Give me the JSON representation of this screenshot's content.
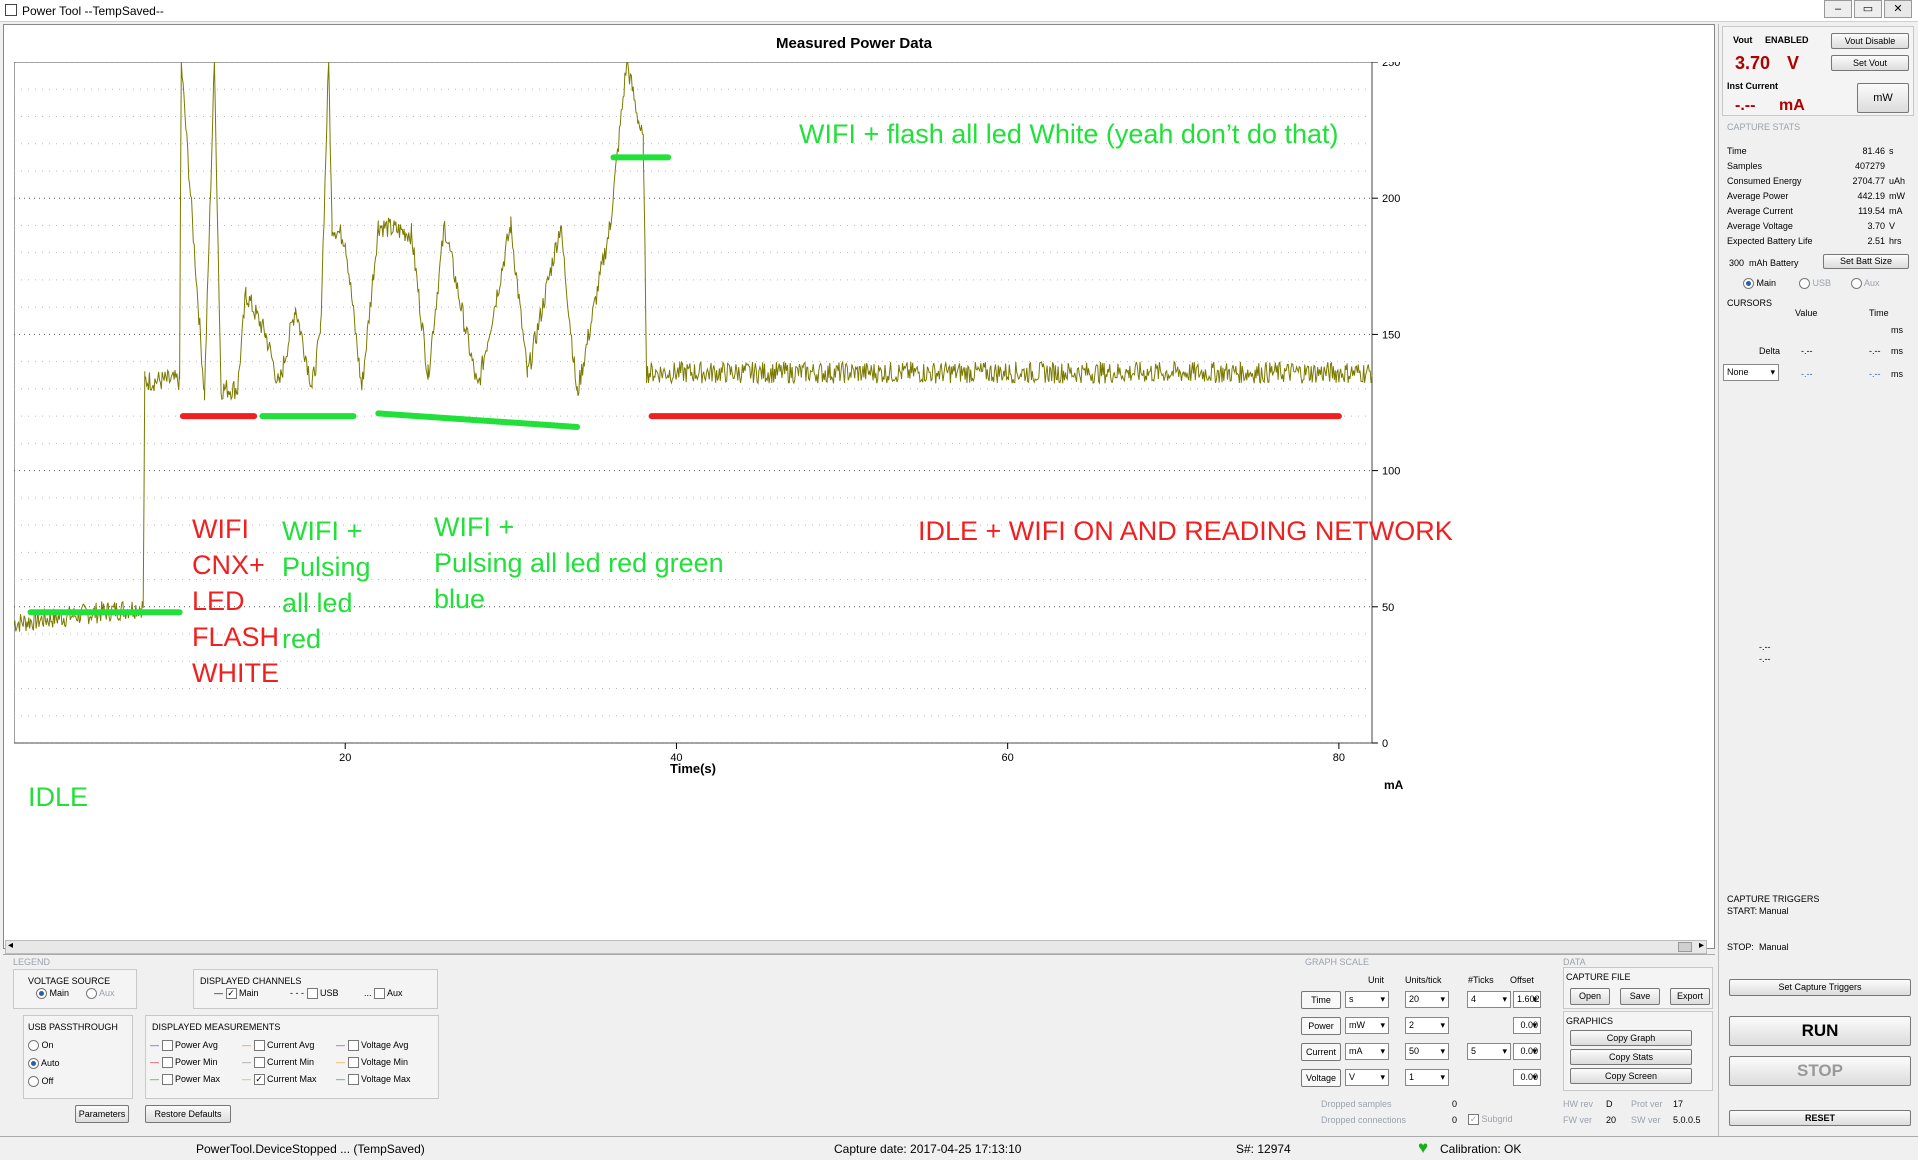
{
  "window": {
    "title": "Power Tool --TempSaved--",
    "controls": [
      "‒",
      "▭",
      "✕"
    ]
  },
  "chart_data": {
    "type": "line",
    "title": "Measured Power Data",
    "xlabel": "Time(s)",
    "ylabel": "mA",
    "xlim": [
      0,
      82
    ],
    "ylim": [
      0,
      250
    ],
    "xticks": [
      20,
      40,
      60,
      80
    ],
    "yticks": [
      0,
      50,
      100,
      150,
      200,
      250
    ],
    "grid": true,
    "line_color": "#7a7a00",
    "series": [
      {
        "name": "Main",
        "points": [
          [
            0,
            44
          ],
          [
            7.8,
            50
          ],
          [
            7.9,
            133
          ],
          [
            10,
            133
          ],
          [
            10.1,
            250
          ],
          [
            11.5,
            128
          ],
          [
            12.1,
            250
          ],
          [
            12.5,
            130
          ],
          [
            13.5,
            130
          ],
          [
            14,
            165
          ],
          [
            15.2,
            150
          ],
          [
            16,
            131
          ],
          [
            17,
            160
          ],
          [
            18,
            131
          ],
          [
            18.5,
            150
          ],
          [
            19,
            250
          ],
          [
            19.2,
            190
          ],
          [
            20,
            185
          ],
          [
            21,
            130
          ],
          [
            22,
            190
          ],
          [
            24,
            187
          ],
          [
            25,
            135
          ],
          [
            26,
            190
          ],
          [
            28,
            130
          ],
          [
            30,
            190
          ],
          [
            31,
            135
          ],
          [
            33,
            190
          ],
          [
            34,
            128
          ],
          [
            36,
            190
          ],
          [
            37,
            250
          ],
          [
            38,
            220
          ],
          [
            38.2,
            136
          ],
          [
            82,
            136
          ]
        ]
      }
    ]
  },
  "annotations": {
    "wifi_flash_white": "WIFI + flash all led White (yeah don’t do that)",
    "idle": "IDLE",
    "wifi_cnx": [
      "WIFI",
      "CNX+",
      "LED",
      "FLASH",
      "WHITE"
    ],
    "wifi_pulse_red": [
      "WIFI +",
      "Pulsing",
      "all led",
      "red"
    ],
    "wifi_pulse_rgb": [
      "WIFI +",
      "Pulsing all led red green",
      "blue"
    ],
    "idle_wifi": "IDLE + WIFI ON AND READING NETWORK"
  },
  "right": {
    "vout_label": "Vout",
    "vout_state": "ENABLED",
    "vout_value": "3.70",
    "vout_unit": "V",
    "vout_disable": "Vout Disable",
    "set_vout": "Set Vout",
    "inst_label": "Inst Current",
    "inst_value": "-.--",
    "inst_unit": "mA",
    "mw": "mW",
    "capture_stats": "CAPTURE STATS",
    "stats": [
      {
        "k": "Time",
        "v": "81.46",
        "u": "s"
      },
      {
        "k": "Samples",
        "v": "407279",
        "u": ""
      },
      {
        "k": "Consumed Energy",
        "v": "2704.77",
        "u": "uAh"
      },
      {
        "k": "Average Power",
        "v": "442.19",
        "u": "mW"
      },
      {
        "k": "Average Current",
        "v": "119.54",
        "u": "mA"
      },
      {
        "k": "Average Voltage",
        "v": "3.70",
        "u": "V"
      },
      {
        "k": "Expected Battery Life",
        "v": "2.51",
        "u": "hrs"
      }
    ],
    "battery_value": "300",
    "battery_unit": "mAh Battery",
    "set_batt": "Set Batt Size",
    "src_main": "Main",
    "src_usb": "USB",
    "src_aux": "Aux",
    "cursors": "CURSORS",
    "col_value": "Value",
    "col_time": "Time",
    "cursor_dash": "-.--",
    "cursor_ms": "ms",
    "delta": "Delta",
    "none_select": "None",
    "mid_dash1": "-.--",
    "mid_dash2": "-.--",
    "capture_triggers": "CAPTURE TRIGGERS",
    "start_label": "START:",
    "start_value": "Manual",
    "stop_label": "STOP:",
    "stop_value": "Manual",
    "set_triggers": "Set Capture Triggers",
    "run": "RUN",
    "stop": "STOP",
    "reset": "RESET"
  },
  "bottom": {
    "legend": "LEGEND",
    "voltage_source": "VOLTAGE SOURCE",
    "vs_main": "Main",
    "vs_aux": "Aux",
    "displayed_channels": "DISPLAYED CHANNELS",
    "ch_main": "Main",
    "ch_usb": "USB",
    "ch_aux": "Aux",
    "usb_passthrough": "USB PASSTHROUGH",
    "usb_on": "On",
    "usb_auto": "Auto",
    "usb_off": "Off",
    "displayed_measurements": "DISPLAYED MEASUREMENTS",
    "meas": [
      "Power Avg",
      "Power Min",
      "Power Max",
      "Current Avg",
      "Current Min",
      "Current Max",
      "Voltage Avg",
      "Voltage Min",
      "Voltage Max"
    ],
    "parameters": "Parameters",
    "restore_defaults": "Restore Defaults",
    "graph_scale": "GRAPH SCALE",
    "col_unit": "Unit",
    "col_units_tick": "Units/tick",
    "col_ticks": "#Ticks",
    "col_offset": "Offset",
    "rows": [
      {
        "name": "Time",
        "unit": "s",
        "upt": "20",
        "ticks": "4",
        "offset": "1.602"
      },
      {
        "name": "Power",
        "unit": "mW",
        "upt": "2",
        "ticks": "",
        "offset": "0.00"
      },
      {
        "name": "Current",
        "unit": "mA",
        "upt": "50",
        "ticks": "5",
        "offset": "0.00"
      },
      {
        "name": "Voltage",
        "unit": "V",
        "upt": "1",
        "ticks": "",
        "offset": "0.00"
      }
    ],
    "dropped_samples": "Dropped samples",
    "dropped_samples_v": "0",
    "dropped_conn": "Dropped connections",
    "dropped_conn_v": "0",
    "subgrid": "Subgrid",
    "data": "DATA",
    "capture_file": "CAPTURE FILE",
    "open": "Open",
    "save": "Save",
    "export": "Export",
    "graphics": "GRAPHICS",
    "copy_graph": "Copy Graph",
    "copy_stats": "Copy Stats",
    "copy_screen": "Copy Screen",
    "hw_rev": "HW rev",
    "hw_rev_v": "D",
    "prot_ver": "Prot ver",
    "prot_ver_v": "17",
    "fw_ver": "FW ver",
    "fw_ver_v": "20",
    "sw_ver": "SW ver",
    "sw_ver_v": "5.0.0.5"
  },
  "status": {
    "left": "PowerTool.DeviceStopped ... (TempSaved)",
    "capture_date": "Capture date: 2017-04-25 17:13:10",
    "serial": "S#: 12974",
    "calibration": "Calibration: OK"
  }
}
